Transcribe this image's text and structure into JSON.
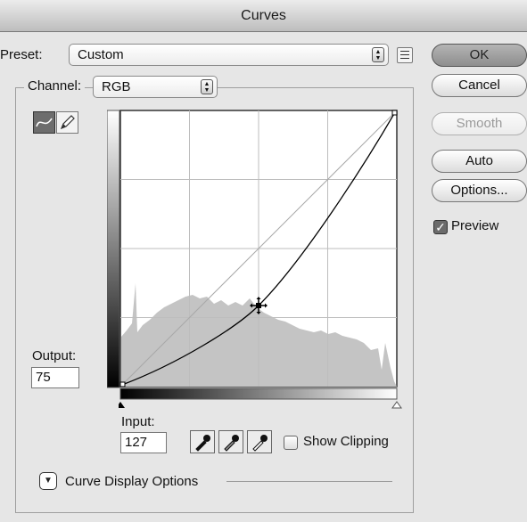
{
  "window": {
    "title": "Curves"
  },
  "preset": {
    "label": "Preset:",
    "value": "Custom"
  },
  "channel": {
    "label": "Channel:",
    "value": "RGB"
  },
  "buttons": {
    "ok": "OK",
    "cancel": "Cancel",
    "smooth": "Smooth",
    "auto": "Auto",
    "options": "Options..."
  },
  "preview": {
    "label": "Preview",
    "checked": true
  },
  "output": {
    "label": "Output:",
    "value": "75"
  },
  "input": {
    "label": "Input:",
    "value": "127"
  },
  "show_clipping": {
    "label": "Show Clipping",
    "checked": false
  },
  "curve_display_options": {
    "label": "Curve Display Options"
  },
  "tools": [
    "curve-tool-icon",
    "pencil-tool-icon"
  ],
  "eyedroppers": [
    "black-point-eyedropper-icon",
    "gray-point-eyedropper-icon",
    "white-point-eyedropper-icon"
  ],
  "curve_points": [
    [
      0,
      0
    ],
    [
      127,
      75
    ],
    [
      255,
      255
    ]
  ],
  "colors": {
    "histogram": "#c4c4c4",
    "curve": "#000000",
    "grid": "#bdbdbd"
  }
}
